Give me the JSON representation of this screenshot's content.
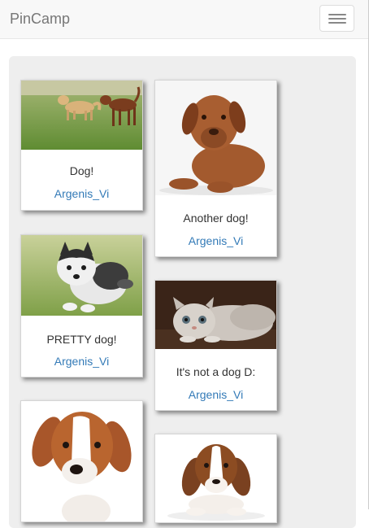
{
  "navbar": {
    "brand": "PinCamp"
  },
  "pins": [
    {
      "title": "Dog!",
      "author": "Argenis_Vi",
      "image": "two-dogs-running-on-grass"
    },
    {
      "title": "Another dog!",
      "author": "Argenis_Vi",
      "image": "brown-puppy"
    },
    {
      "title": "PRETTY dog!",
      "author": "Argenis_Vi",
      "image": "husky-puppy"
    },
    {
      "title": "It's not a dog D:",
      "author": "Argenis_Vi",
      "image": "grey-cat"
    },
    {
      "title": "",
      "author": "",
      "image": "brown-white-puppy"
    },
    {
      "title": "",
      "author": "",
      "image": "beagle-puppy"
    }
  ]
}
